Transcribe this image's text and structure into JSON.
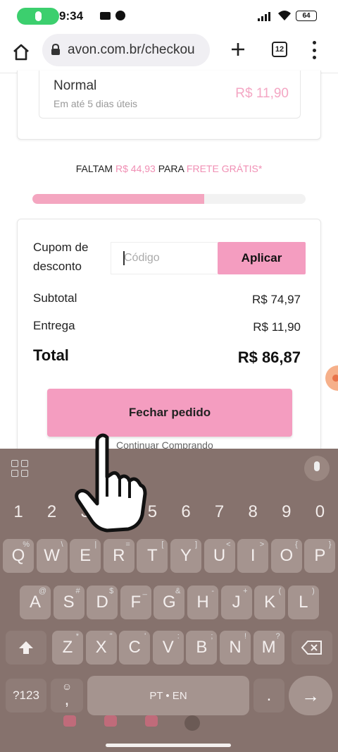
{
  "status_bar": {
    "time": "9:34",
    "battery": "64"
  },
  "browser": {
    "url": "avon.com.br/checkou",
    "tab_count": "12"
  },
  "shipping": {
    "name": "Normal",
    "sub": "Em até 5 dias úteis",
    "price": "R$ 11,90"
  },
  "free_shipping": {
    "prefix": "FALTAM",
    "amount": "R$ 44,93",
    "middle": "PARA",
    "suffix": "FRETE GRÁTIS*",
    "progress": 0.63
  },
  "summary": {
    "coupon_label": "Cupom de desconto",
    "coupon_placeholder": "Código",
    "apply_label": "Aplicar",
    "subtotal_label": "Subtotal",
    "subtotal_value": "R$ 74,97",
    "delivery_label": "Entrega",
    "delivery_value": "R$ 11,90",
    "total_label": "Total",
    "total_value": "R$ 86,87",
    "checkout_label": "Fechar pedido",
    "continue_label": "Continuar Comprando"
  },
  "keyboard": {
    "numbers": [
      "1",
      "2",
      "3",
      "4",
      "5",
      "6",
      "7",
      "8",
      "9",
      "0"
    ],
    "row1": [
      [
        "Q",
        "%"
      ],
      [
        "W",
        "\\"
      ],
      [
        "E",
        "|"
      ],
      [
        "R",
        "="
      ],
      [
        "T",
        "["
      ],
      [
        "Y",
        "]"
      ],
      [
        "U",
        "<"
      ],
      [
        "I",
        ">"
      ],
      [
        "O",
        "{"
      ],
      [
        "P",
        "}"
      ]
    ],
    "row2": [
      [
        "A",
        "@"
      ],
      [
        "S",
        "#"
      ],
      [
        "D",
        "$"
      ],
      [
        "F",
        "_"
      ],
      [
        "G",
        "&"
      ],
      [
        "H",
        "-"
      ],
      [
        "J",
        "+"
      ],
      [
        "K",
        "("
      ],
      [
        "L",
        ")"
      ]
    ],
    "row3": [
      [
        "Z",
        "*"
      ],
      [
        "X",
        "\""
      ],
      [
        "C",
        "'"
      ],
      [
        "V",
        ":"
      ],
      [
        "B",
        ";"
      ],
      [
        "N",
        "!"
      ],
      [
        "M",
        "?"
      ]
    ],
    "symbols_label": "?123",
    "comma": ",",
    "space_label": "PT • EN",
    "period": ".",
    "enter_glyph": "→"
  },
  "colors": {
    "accent_pink": "#f49dc0",
    "keyboard_bg": "#86726d",
    "mic_green": "#3ccf6e"
  }
}
